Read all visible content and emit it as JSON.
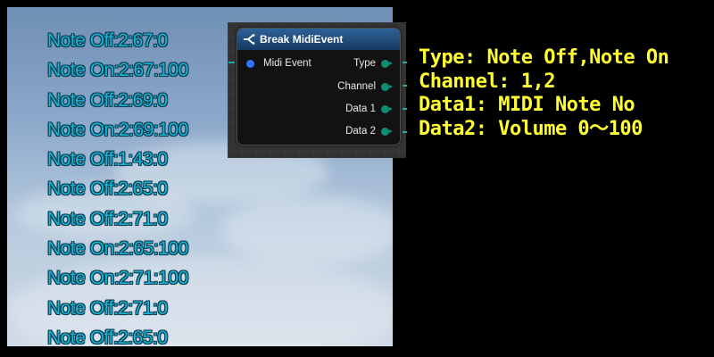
{
  "log_lines": [
    "Note Off:2:67:0",
    "Note On:2:67:100",
    "Note Off:2:69:0",
    "Note On:2:69:100",
    "Note Off:1:43:0",
    "Note Off:2:65:0",
    "Note Off:2:71:0",
    "Note On:2:65:100",
    "Note On:2:71:100",
    "Note Off:2:71:0",
    "Note Off:2:65:0"
  ],
  "node": {
    "title": "Break MidiEvent",
    "icon": "break-struct-icon",
    "input_pin": "Midi Event",
    "output_pins": [
      "Type",
      "Channel",
      "Data 1",
      "Data 2"
    ],
    "header_color": "#2d6199",
    "input_pin_color": "#2f73ff",
    "output_pin_color": "#118c74"
  },
  "annotations": [
    "Type: Note Off,Note On",
    "Channel: 1,2",
    "Data1: MIDI Note No",
    "Data2: Volume 0〜100"
  ],
  "colors": {
    "log_text": "#16b4d6",
    "annotation_text": "#ffff33",
    "background": "#000000"
  }
}
